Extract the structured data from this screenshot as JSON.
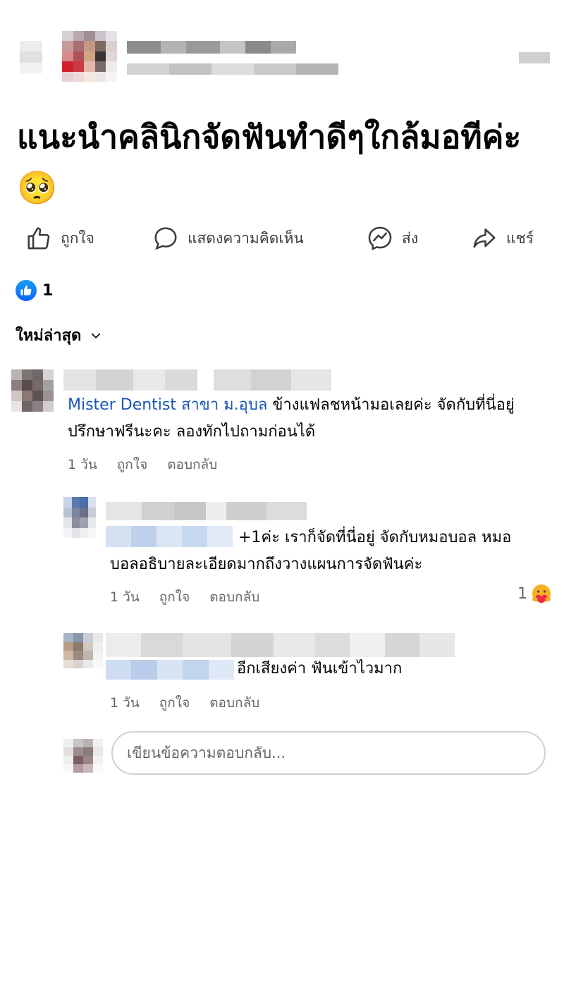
{
  "post": {
    "title": "แนะนำคลินิกจัดฟันทำดีๆใกล้มอทีค่ะ🥺"
  },
  "actions": {
    "like": "ถูกใจ",
    "comment": "แสดงความคิดเห็น",
    "send": "ส่ง",
    "share": "แชร์"
  },
  "reactions": {
    "count": "1"
  },
  "sort": {
    "label": "ใหม่ล่าสุด"
  },
  "comments": [
    {
      "mention": "Mister Dentist สาขา ม.อุบล",
      "text": " ข้างแฟลชหน้ามอเลยค่ะ จัดกับที่นี่อยู่ ปรึกษาฟรีนะคะ ลองทักไปถามก่อนได้",
      "time": "1 วัน",
      "like": "ถูกใจ",
      "reply": "ตอบกลับ"
    },
    {
      "text": "+1ค่ะ เราก็จัดที่นี่อยู่ จัดกับหมอบอล หมอบอลอธิบายละเอียดมากถึงวางแผนการจัดฟันค่ะ",
      "time": "1 วัน",
      "like": "ถูกใจ",
      "reply": "ตอบกลับ",
      "reaction_count": "1"
    },
    {
      "text": "อีกเสียงค่า ฟันเข้าไวมาก",
      "time": "1 วัน",
      "like": "ถูกใจ",
      "reply": "ตอบกลับ"
    }
  ],
  "reply_box": {
    "placeholder": "เขียนข้อความตอบกลับ..."
  },
  "colors": {
    "brand_blue": "#0866ff",
    "mention": "#1a56b8",
    "meta_gray": "#65676b"
  }
}
